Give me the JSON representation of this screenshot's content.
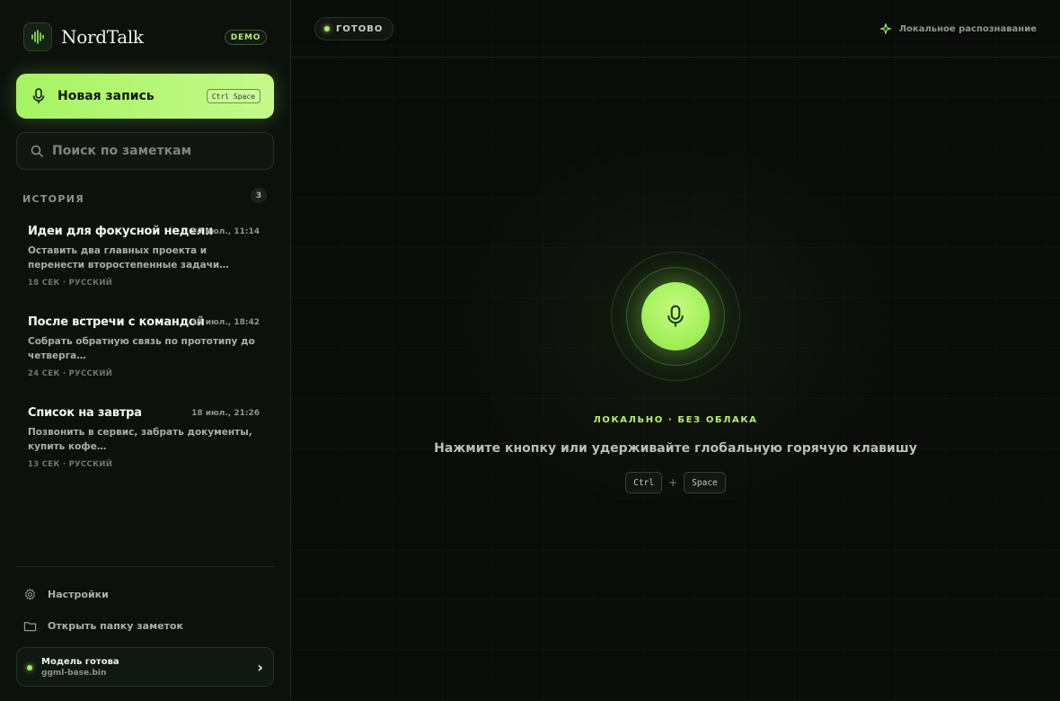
{
  "app": {
    "name": "NordTalk",
    "badge": "DEMO"
  },
  "sidebar": {
    "new_recording": {
      "label": "Новая запись",
      "shortcut": "Ctrl Space"
    },
    "search": {
      "placeholder": "Поиск по заметкам",
      "value": ""
    },
    "history": {
      "title": "ИСТОРИЯ",
      "count": "3",
      "items": [
        {
          "title": "Идеи для фокусной недели",
          "date": "20 июл., 11:14",
          "preview": "Оставить два главных проекта и перенести второстепенные задачи…",
          "meta": "18 СЕК · РУССКИЙ"
        },
        {
          "title": "После встречи с командой",
          "date": "19 июл., 18:42",
          "preview": "Собрать обратную связь по прототипу до четверга…",
          "meta": "24 СЕК · РУССКИЙ"
        },
        {
          "title": "Список на завтра",
          "date": "18 июл., 21:26",
          "preview": "Позвонить в сервис, забрать документы, купить кофе…",
          "meta": "13 СЕК · РУССКИЙ"
        }
      ]
    },
    "links": {
      "settings": "Настройки",
      "open_folder": "Открыть папку заметок"
    },
    "model": {
      "title": "Модель готова",
      "file": "ggml-base.bin"
    }
  },
  "header": {
    "status": "ГОТОВО",
    "mode": "Локальное распознавание"
  },
  "main": {
    "tagline": "ЛОКАЛЬНО · БЕЗ ОБЛАКА",
    "hint": "Нажмите кнопку или удерживайте глобальную горячую клавишу",
    "keys": [
      "Ctrl",
      "Space"
    ],
    "key_joiner": "+"
  },
  "colors": {
    "accent": "#a6f463",
    "background": "#0a0c0a",
    "sidebar": "#0c110c"
  },
  "icons": {
    "logo": "waveform-icon",
    "record": "microphone-icon",
    "search": "search-icon",
    "settings": "gear-icon",
    "folder": "folder-icon",
    "mode": "sparkle-icon",
    "chevron": "chevron-right-icon"
  }
}
